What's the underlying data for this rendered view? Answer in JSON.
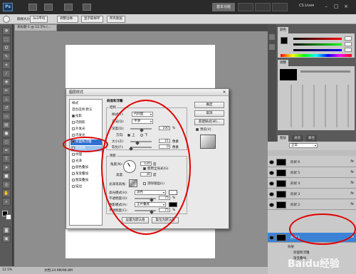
{
  "appbar": {
    "logo": "Ps",
    "essentials": "基本功能",
    "cs_live": "CS Live▾",
    "win_min": "–",
    "win_max": "□",
    "win_close": "×"
  },
  "options_bar": {
    "sample_label": "取样大小",
    "sample_value": "3x3平均",
    "refine_edge": "调整边缘...",
    "show_ring": "显示取样环",
    "sample_all": "所有图层"
  },
  "document": {
    "tab_title": "未标题-1 @ 12.5% (...",
    "zoom": "12.5%",
    "doc_info": "文档:24.9M/98.8M"
  },
  "dialog": {
    "title": "图层样式",
    "close": "×",
    "styles": [
      {
        "label": "样式",
        "checked": false
      },
      {
        "label": "混合选项:默认",
        "checked": false
      },
      {
        "label": "投影",
        "checked": true
      },
      {
        "label": "内阴影",
        "checked": false
      },
      {
        "label": "外发光",
        "checked": false
      },
      {
        "label": "内发光",
        "checked": false
      },
      {
        "label": "斜面和浮雕",
        "checked": true
      },
      {
        "label": "等高线",
        "checked": false
      },
      {
        "label": "纹理",
        "checked": false
      },
      {
        "label": "光泽",
        "checked": false
      },
      {
        "label": "颜色叠加",
        "checked": false
      },
      {
        "label": "渐变叠加",
        "checked": false
      },
      {
        "label": "图案叠加",
        "checked": false
      },
      {
        "label": "描边",
        "checked": false
      }
    ],
    "bevel_section_title": "斜面和浮雕",
    "structure_title": "结构",
    "style_label": "样式(T):",
    "style_value": "内斜面",
    "technique_label": "方法(Q):",
    "technique_value": "平滑",
    "depth_label": "深度(D):",
    "depth_value": "100",
    "depth_unit": "%",
    "direction_label": "方向:",
    "direction_up": "上",
    "direction_down": "下",
    "size_label": "大小(Z):",
    "size_value": "21",
    "size_unit": "像素",
    "soften_label": "软化(F):",
    "soften_value": "0",
    "soften_unit": "像素",
    "shading_title": "阴影",
    "angle_label": "角度(N):",
    "angle_value": "120",
    "angle_unit": "度",
    "global_light": "使用全局光(G)",
    "altitude_label": "高度:",
    "altitude_value": "30",
    "altitude_unit": "度",
    "gloss_label": "光泽等高线:",
    "anti_alias": "消除锯齿(L)",
    "highlight_label": "高光模式(H):",
    "highlight_value": "滤色",
    "highlight_opacity_label": "不透明度(O):",
    "highlight_opacity": "75",
    "shadow_label": "阴影模式(A):",
    "shadow_value": "正片叠底",
    "shadow_opacity_label": "不透明度(C):",
    "shadow_opacity": "75",
    "pct": "%",
    "set_default": "设置为默认值",
    "reset_default": "复位为默认值",
    "ok": "确定",
    "cancel": "取消",
    "new_style": "新建样式(W)...",
    "preview": "预览(V)"
  },
  "layers_panel": {
    "tab1": "图层",
    "tab2": "通道",
    "tab3": "路径",
    "blend_mode": "正常",
    "layers": [
      {
        "name": "形状 6",
        "fx": "fx"
      },
      {
        "name": "形状 5",
        "fx": "fx"
      },
      {
        "name": "形状 4",
        "fx": "fx"
      },
      {
        "name": "形状 3",
        "fx": "fx"
      },
      {
        "name": "形状 2",
        "fx": "fx"
      },
      {
        "name": "形状 1",
        "fx": "fx"
      }
    ],
    "effects_label": "效果",
    "effect_1": "斜面和浮雕",
    "effect_2": "渐变叠加"
  },
  "watermark": "Baidu经验",
  "colors": {
    "annotation": "#e00000",
    "selected_layer": "#3b82d6",
    "selected_style": "#2f6fd0"
  }
}
